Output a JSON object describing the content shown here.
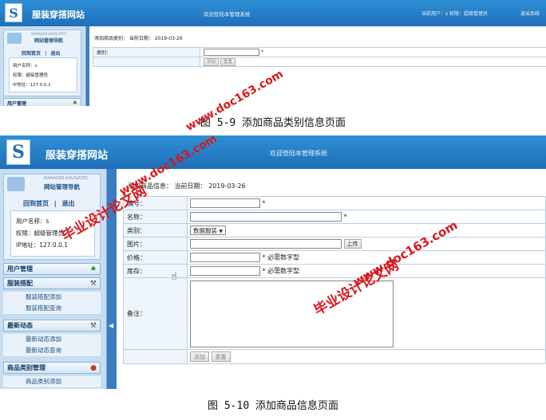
{
  "fig1": {
    "site_title": "服装穿搭网站",
    "welcome": "欢迎登陆本管理系统",
    "current_user": "当前用户：s 权限：超级管理员",
    "logout_top": "退出系统",
    "nav_logo_text": "MANAGER NAVIGATES",
    "nav_title": "网站管理导航",
    "home_link": "回到首页",
    "link_sep": "|",
    "exit_link": "退出",
    "user_line": "用户名称：s",
    "role_line": "权限：超级管理员",
    "ip_line": "IP地址：127.0.0.1",
    "menu_user": "用户管理",
    "crumb": "添加商品类别：  当前日期：  2019-03-26",
    "field_label": "类别：",
    "required_mark": "*",
    "add_btn": "添加",
    "reset_btn": "重置",
    "caption": "图 5-9 添加商品类别信息页面"
  },
  "fig2": {
    "site_title": "服装穿搭网站",
    "welcome": "欢迎登陆本管理系统",
    "nav_logo_text": "MANAGER NAVIGATES",
    "nav_title": "网站管理导航",
    "home_link": "回到首页",
    "link_sep": "|",
    "exit_link": "退出",
    "user_line": "用户名称：s",
    "role_line": "权限：超级管理员",
    "ip_line": "IP地址：127.0.0.1",
    "menu_user": "用户管理",
    "menu_outfit": "服装搭配",
    "sub_outfit_add": "服装搭配添加",
    "sub_outfit_query": "服装搭配查询",
    "menu_news": "最新动态",
    "sub_news_add": "最新动态添加",
    "sub_news_query": "最新动态查询",
    "menu_category": "商品类别管理",
    "sub_category_add": "商品类别添加",
    "crumb": "添加商品信息：  当前日期：  2019-03-26",
    "label_no": "编号：",
    "label_name": "名称：",
    "label_category": "类别：",
    "category_selected": "数据服装",
    "label_image": "图片：",
    "upload_btn": "上传",
    "label_price": "价格：",
    "price_hint": "* 必需数字型",
    "label_stock": "库存：",
    "stock_hint": "* 必需数字型",
    "label_remark": "备注：",
    "required_mark": "*",
    "add_btn": "添加",
    "reset_btn": "重置",
    "caption": "图 5-10 添加商品信息页面"
  },
  "watermarks": {
    "text_cn": "毕业设计论文网",
    "text_url": "www.doc163.com"
  },
  "icons": {
    "logo": "s-logo-icon",
    "expand": "chevron-left-icon",
    "cursor": "hand-cursor-icon",
    "menu_user": "users-icon",
    "menu_outfit": "tools-icon",
    "menu_news": "tools-icon",
    "menu_category": "people-icon"
  },
  "colors": {
    "header_blue": "#1e6fb8",
    "sidebar_blue": "#c7ddf0",
    "watermark_red": "#d8181c"
  }
}
